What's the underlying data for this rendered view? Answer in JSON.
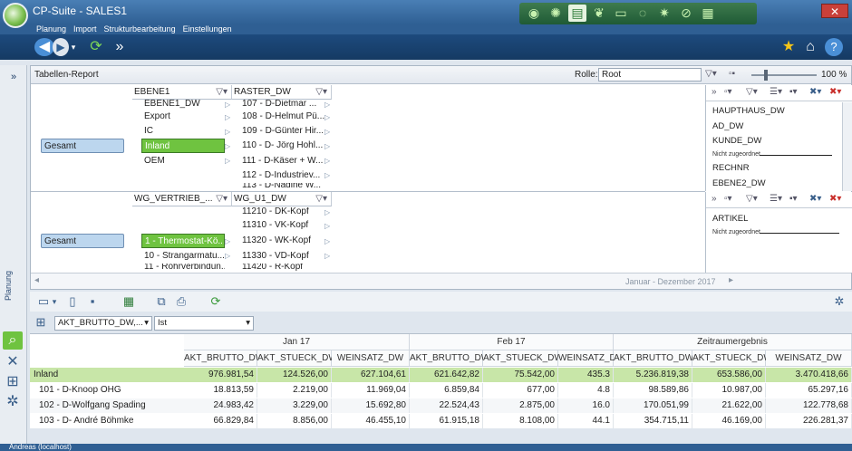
{
  "app": {
    "title": "CP-Suite - SALES1",
    "close": "✕"
  },
  "menu": [
    "Planung",
    "Import",
    "Strukturbearbeitung",
    "Einstellungen"
  ],
  "quickbar_icons": [
    "globe-icon",
    "bulb-icon",
    "money-icon",
    "leaf-icon",
    "cash-icon",
    "refresh-icon",
    "gears-icon",
    "edit-icon",
    "building-icon"
  ],
  "sidebar": {
    "expand": "»",
    "label": "Planung"
  },
  "report": {
    "title": "Tabellen-Report",
    "rolle_label": "Rolle:",
    "rolle_value": "Root",
    "zoom": "100 %",
    "top": {
      "col1": "EBENE1",
      "col2": "RASTER_DW",
      "root": "Gesamt",
      "col1_items": [
        "EBENE1_DW",
        "Export",
        "IC",
        "Inland",
        "OEM"
      ],
      "col2_items": [
        "107 - D-Dietmar ...",
        "108 - D-Helmut Pü...",
        "109 - D-Günter Hir...",
        "110 - D- Jörg Hohl...",
        "111 - D-Käser + W...",
        "112 - D-Industriev...",
        "113 - D-Nadine W..."
      ],
      "right": [
        "HAUPTHAUS_DW",
        "AD_DW",
        "KUNDE_DW",
        "Nicht zugeordnet",
        "RECHNR",
        "EBENE2_DW"
      ]
    },
    "bottom": {
      "col1": "WG_VERTRIEB_...",
      "col2": "WG_U1_DW",
      "root": "Gesamt",
      "col1_items": [
        "1 - Thermostat-Kö...",
        "10 - Strangarmatu...",
        "11 - Rohrverbindun..."
      ],
      "col2_items": [
        "11210 - DK-Kopf",
        "11310 - VK-Kopf",
        "11320 - WK-Kopf",
        "11330 - VD-Kopf",
        "11420 - R-Kopf"
      ],
      "right": [
        "ARTIKEL",
        "Nicht zugeordnet"
      ]
    },
    "period": "Januar - Dezember 2017"
  },
  "filters": {
    "measure": "AKT_BRUTTO_DW,...",
    "version": "Ist"
  },
  "grid": {
    "groups": [
      "Jan 17",
      "Feb 17",
      "Zeitraumergebnis"
    ],
    "columns": [
      "AKT_BRUTTO_DW",
      "AKT_STUECK_DW",
      "WEINSATZ_DW",
      "AKT_BRUTTO_DW",
      "AKT_STUECK_DW",
      "WEINSATZ_DW",
      "AKT_BRUTTO_DW",
      "AKT_STUECK_DW",
      "WEINSATZ_DW"
    ],
    "rows": [
      {
        "label": "Inland",
        "values": [
          "976.981,54",
          "124.526,00",
          "627.104,61",
          "621.642,82",
          "75.542,00",
          "435.3",
          "5.236.819,38",
          "653.586,00",
          "3.470.418,66"
        ]
      },
      {
        "label": "101 - D-Knoop OHG",
        "values": [
          "18.813,59",
          "2.219,00",
          "11.969,04",
          "6.859,84",
          "677,00",
          "4.8",
          "98.589,86",
          "10.987,00",
          "65.297,16"
        ]
      },
      {
        "label": "102 - D-Wolfgang Spading",
        "values": [
          "24.983,42",
          "3.229,00",
          "15.692,80",
          "22.524,43",
          "2.875,00",
          "16.0",
          "170.051,99",
          "21.622,00",
          "122.778,68"
        ]
      },
      {
        "label": "103 - D- André Böhmke",
        "values": [
          "66.829,84",
          "8.856,00",
          "46.455,10",
          "61.915,18",
          "8.108,00",
          "44.1",
          "354.715,11",
          "46.169,00",
          "226.281,37"
        ]
      }
    ]
  },
  "status": {
    "user": "Andreas (localhost)"
  },
  "colors": {
    "accent_green": "#6fc340",
    "nav_blue": "#2f5f93"
  }
}
